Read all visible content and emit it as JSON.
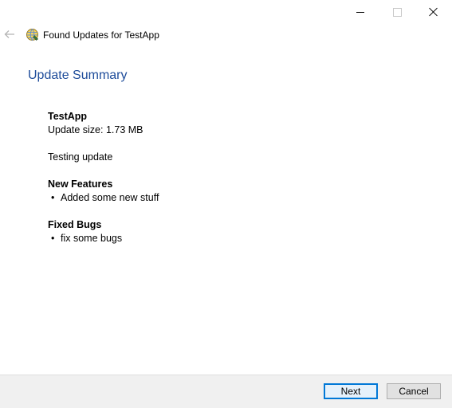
{
  "window": {
    "title": "Found Updates for TestApp"
  },
  "page": {
    "title": "Update Summary"
  },
  "update": {
    "app_name": "TestApp",
    "size_text": "Update size: 1.73 MB",
    "description": "Testing update",
    "new_features_heading": "New Features",
    "new_features": [
      "Added some new stuff"
    ],
    "fixed_bugs_heading": "Fixed Bugs",
    "fixed_bugs": [
      "fix some bugs"
    ]
  },
  "footer": {
    "next_label": "Next",
    "cancel_label": "Cancel"
  },
  "icons": {
    "back": "back-arrow-icon",
    "app": "update-app-icon",
    "minimize": "minimize-icon",
    "maximize": "maximize-icon",
    "close": "close-icon"
  },
  "colors": {
    "title_accent": "#1e4c9a",
    "default_button_border": "#0078d7",
    "footer_background": "#f0f0f0"
  }
}
